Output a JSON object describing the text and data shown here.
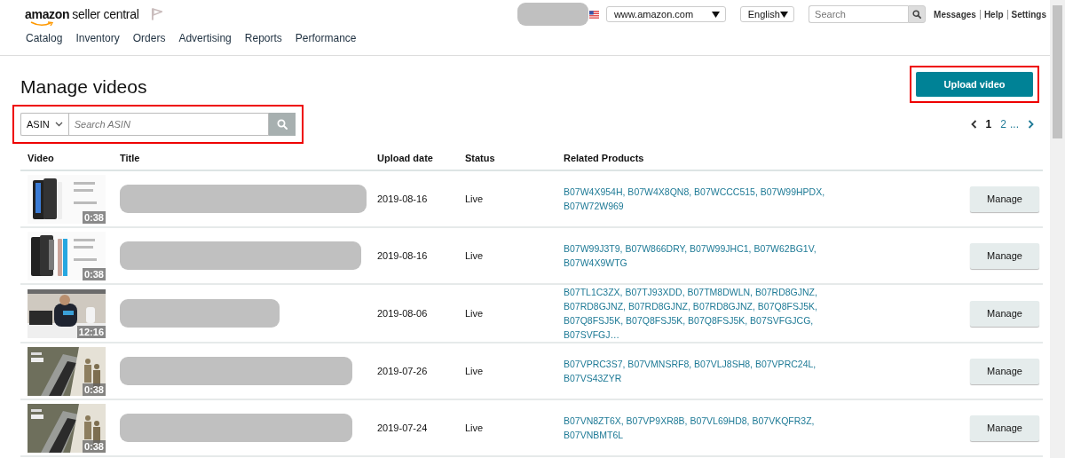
{
  "header": {
    "logo": {
      "brand": "amazon",
      "product": "seller central"
    },
    "marketplace": {
      "value": "www.amazon.com"
    },
    "language": {
      "value": "English"
    },
    "search": {
      "placeholder": "Search"
    },
    "links": [
      "Messages",
      "Help",
      "Settings"
    ]
  },
  "nav": [
    "Catalog",
    "Inventory",
    "Orders",
    "Advertising",
    "Reports",
    "Performance"
  ],
  "page": {
    "title": "Manage videos",
    "upload_button": {
      "label": "Upload video",
      "highlighted": true
    },
    "filter": {
      "type": "ASIN",
      "placeholder": "Search ASIN",
      "highlighted": true
    },
    "pagination": {
      "pages": [
        {
          "label": "1",
          "selected": true
        },
        {
          "label": "2",
          "selected": false
        }
      ],
      "ellipsis": "..."
    }
  },
  "table": {
    "columns": [
      "Video",
      "Title",
      "Upload date",
      "Status",
      "Related Products"
    ],
    "rows": [
      {
        "thumbnail": {
          "kind": "picture",
          "duration": "0:38"
        },
        "upload_date": "2019-08-16",
        "status": "Live",
        "products": "B07W4X954H, B07W4X8QN8, B07WCCC515, B07W99HPDX, B07W72W969",
        "action": "Manage"
      },
      {
        "thumbnail": {
          "kind": "picture",
          "duration": "0:38"
        },
        "upload_date": "2019-08-16",
        "status": "Live",
        "products": "B07W99J3T9, B07W866DRY, B07W99JHC1, B07W62BG1V, B07W4X9WTG",
        "action": "Manage"
      },
      {
        "thumbnail": {
          "kind": "picture",
          "duration": "12:16"
        },
        "upload_date": "2019-08-06",
        "status": "Live",
        "products": "B07TL1C3ZX, B07TJ93XDD, B07TM8DWLN, B07RD8GJNZ, B07RD8GJNZ, B07RD8GJNZ, B07RD8GJNZ, B07Q8FSJ5K, B07Q8FSJ5K, B07Q8FSJ5K, B07Q8FSJ5K, B07SVFGJCG, B07SVFGJ…",
        "action": "Manage"
      },
      {
        "thumbnail": {
          "kind": "picture",
          "duration": "0:38"
        },
        "upload_date": "2019-07-26",
        "status": "Live",
        "products": "B07VPRC3S7, B07VMNSRF8, B07VLJ8SH8, B07VPRC24L, B07VS43ZYR",
        "action": "Manage"
      },
      {
        "thumbnail": {
          "kind": "picture",
          "duration": "0:38"
        },
        "upload_date": "2019-07-24",
        "status": "Live",
        "products": "B07VN8ZT6X, B07VP9XR8B, B07VL69HD8, B07VKQFR3Z, B07VNBMT6L",
        "action": "Manage"
      }
    ]
  }
}
